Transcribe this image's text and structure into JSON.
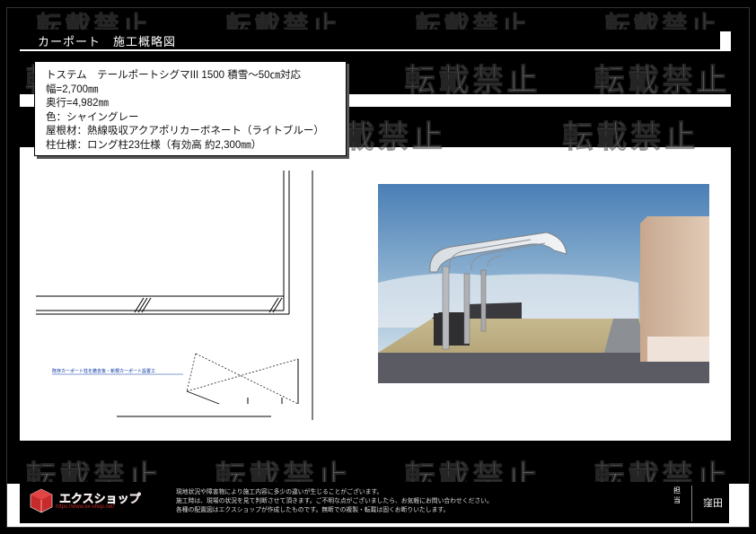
{
  "header": {
    "title": "カーポート　施工概略図"
  },
  "spec": {
    "lines": [
      "トステム　テールポートシグマIII 1500 積雪～50㎝対応",
      "幅=2,700㎜",
      "奥行=4,982㎜",
      "色：シャイングレー",
      "屋根材：熱線吸収アクアポリカーボネート（ライトブルー）",
      "柱仕様：ロング柱23仕様（有効高 約2,300㎜）"
    ]
  },
  "drawing": {
    "note": "既存カーポート柱を撤去後・新規カーポート設置工"
  },
  "watermark": {
    "text": "転載禁止"
  },
  "footer": {
    "logo_text": "エクスショップ",
    "logo_url": "https://www.ex-shop.net/",
    "notes": [
      "現地状況や障害物により施工内容に多少の違いが生じることがございます。",
      "施工時は、現場の状況を見て判断させて頂きます。ご不明な点がございましたら、お気軽にお問い合わせください。",
      "各種の配置図はエクスショップが作成したものです。無断での複製・転載は固くお断りいたします。"
    ],
    "staff_label": "担当",
    "staff_name": "窪田"
  },
  "colors": {
    "brand": "#c62a2a",
    "background": "#000000",
    "paper": "#ffffff"
  }
}
